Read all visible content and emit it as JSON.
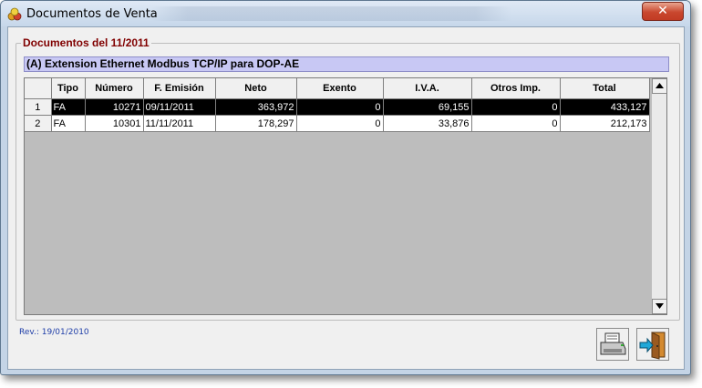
{
  "window": {
    "title": "Documentos de Venta",
    "close_label": "✕"
  },
  "group": {
    "legend": "Documentos del 11/2011"
  },
  "subject": "(A) Extension Ethernet Modbus TCP/IP para DOP-AE",
  "grid": {
    "columns": [
      "Tipo",
      "Número",
      "F. Emisión",
      "Neto",
      "Exento",
      "I.V.A.",
      "Otros Imp.",
      "Total"
    ],
    "rows": [
      {
        "index": "1",
        "tipo": "FA",
        "numero": "10271",
        "fecha": "09/11/2011",
        "neto": "363,972",
        "exento": "0",
        "iva": "69,155",
        "otros": "0",
        "total": "433,127"
      },
      {
        "index": "2",
        "tipo": "FA",
        "numero": "10301",
        "fecha": "11/11/2011",
        "neto": "178,297",
        "exento": "0",
        "iva": "33,876",
        "otros": "0",
        "total": "212,173"
      }
    ]
  },
  "footer": {
    "revision": "Rev.: 19/01/2010"
  },
  "icons": {
    "print": "printer-icon",
    "exit": "exit-door-icon"
  },
  "colors": {
    "legend": "#800000",
    "selected_row": "#000000",
    "subject_bg": "#c8c8f4",
    "revision_text": "#1f3ea8"
  }
}
